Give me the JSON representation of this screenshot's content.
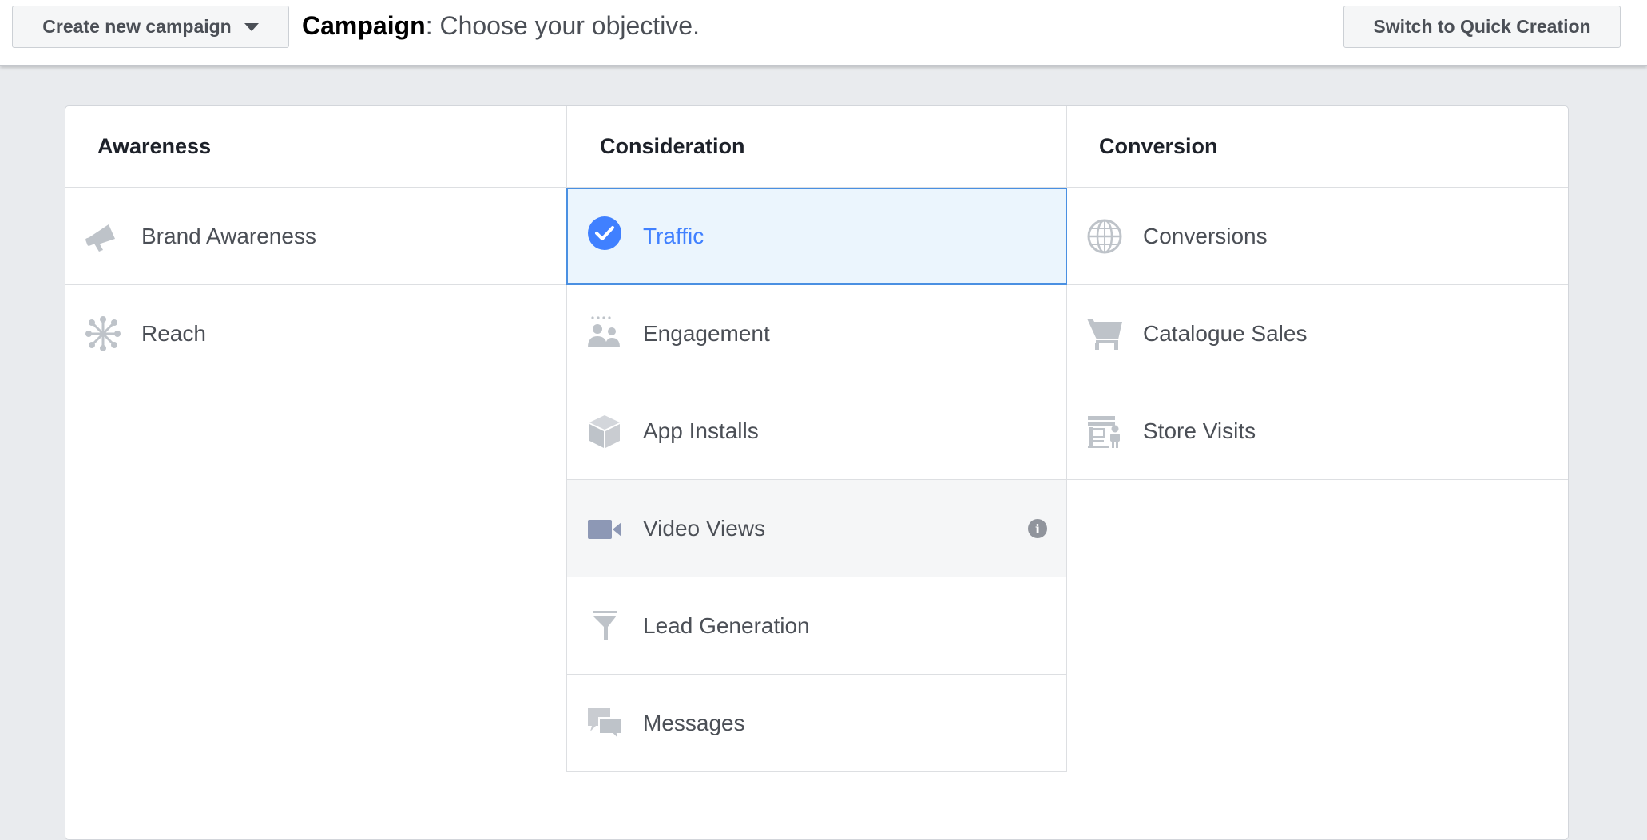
{
  "header": {
    "create_button_label": "Create new campaign",
    "title_bold": "Campaign",
    "title_rest": ": Choose your objective.",
    "switch_button_label": "Switch to Quick Creation"
  },
  "columns": [
    {
      "heading": "Awareness",
      "items": [
        {
          "label": "Brand Awareness",
          "icon": "megaphone-icon"
        },
        {
          "label": "Reach",
          "icon": "reach-icon"
        }
      ]
    },
    {
      "heading": "Consideration",
      "items": [
        {
          "label": "Traffic",
          "icon": "check-circle-icon",
          "selected": true
        },
        {
          "label": "Engagement",
          "icon": "people-icon"
        },
        {
          "label": "App Installs",
          "icon": "box-icon"
        },
        {
          "label": "Video Views",
          "icon": "video-camera-icon",
          "hovered": true
        },
        {
          "label": "Lead Generation",
          "icon": "funnel-icon"
        },
        {
          "label": "Messages",
          "icon": "chat-bubbles-icon"
        }
      ]
    },
    {
      "heading": "Conversion",
      "items": [
        {
          "label": "Conversions",
          "icon": "globe-icon"
        },
        {
          "label": "Catalogue Sales",
          "icon": "shopping-cart-icon"
        },
        {
          "label": "Store Visits",
          "icon": "store-icon"
        }
      ]
    }
  ],
  "colors": {
    "selected_accent": "#4080ff",
    "selected_bg": "#ebf5fd",
    "icon_color": "#bec3c9"
  }
}
